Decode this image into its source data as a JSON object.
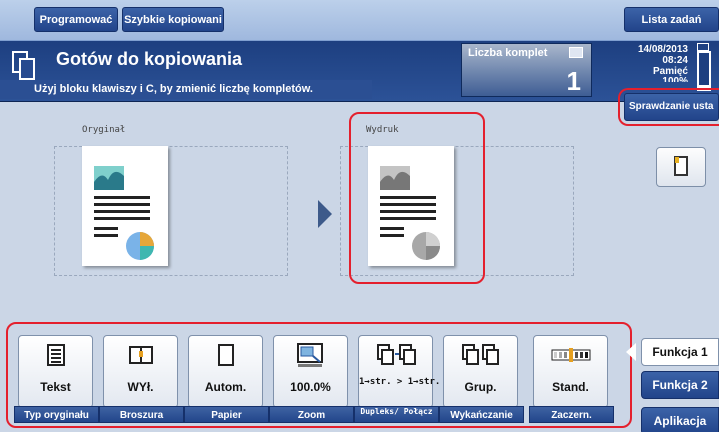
{
  "topbar": {
    "left_buttons": [
      "Programować",
      "Szybkie kopiowani"
    ],
    "right_button": "Lista zadań"
  },
  "status": {
    "title": "Gotów do kopiowania",
    "message": "Użyj bloku klawiszy i C, by zmienić liczbę kompletów.",
    "copies_label": "Liczba komplet",
    "copies_value": "1",
    "date": "14/08/2013",
    "time": "08:24",
    "memory_label": "Pamięć",
    "memory_value": "100%"
  },
  "main": {
    "original_label": "Oryginał",
    "output_label": "Wydruk",
    "check_settings_button": "Sprawdzanie usta"
  },
  "functions": [
    {
      "value": "Tekst",
      "label": "Typ oryginału",
      "icon": "text-original-icon"
    },
    {
      "value": "WYł.",
      "label": "Broszura",
      "icon": "booklet-icon"
    },
    {
      "value": "Autom.",
      "label": "Papier",
      "icon": "paper-icon"
    },
    {
      "value": "100.0%",
      "label": "Zoom",
      "icon": "zoom-icon"
    },
    {
      "value": "1→str. > 1→str.",
      "label": "Dupleks/ Połącz",
      "icon": "duplex-icon"
    },
    {
      "value": "Grup.",
      "label": "Wykańczanie",
      "icon": "finishing-icon"
    },
    {
      "value": "Stand.",
      "label": "Zaczern.",
      "icon": "density-icon"
    }
  ],
  "side_tabs": [
    "Funkcja 1",
    "Funkcja 2",
    "Aplikacja"
  ],
  "colors": {
    "accent": "#22448a",
    "highlight_frame": "#e4202d",
    "background": "#cbd6e6"
  }
}
